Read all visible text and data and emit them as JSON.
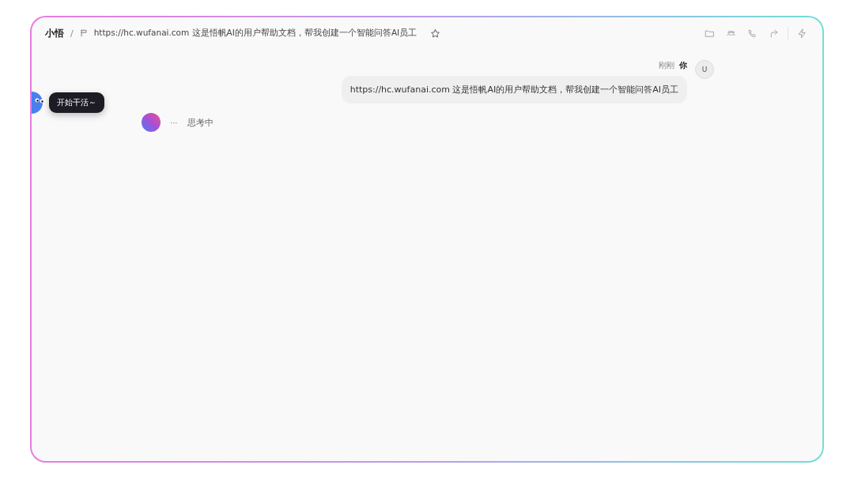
{
  "header": {
    "app_name": "小悟",
    "separator": "/",
    "title": "https://hc.wufanai.com 这是悟帆AI的用户帮助文档，帮我创建一个智能问答AI员工",
    "starred": false
  },
  "mascot": {
    "tooltip": "开始干活～"
  },
  "messages": [
    {
      "kind": "user",
      "time": "刚刚",
      "author": "你",
      "avatar": "U",
      "text": "https://hc.wufanai.com 这是悟帆AI的用户帮助文档，帮我创建一个智能问答AI员工"
    },
    {
      "kind": "assistant",
      "dots": "···",
      "status": "思考中"
    }
  ]
}
